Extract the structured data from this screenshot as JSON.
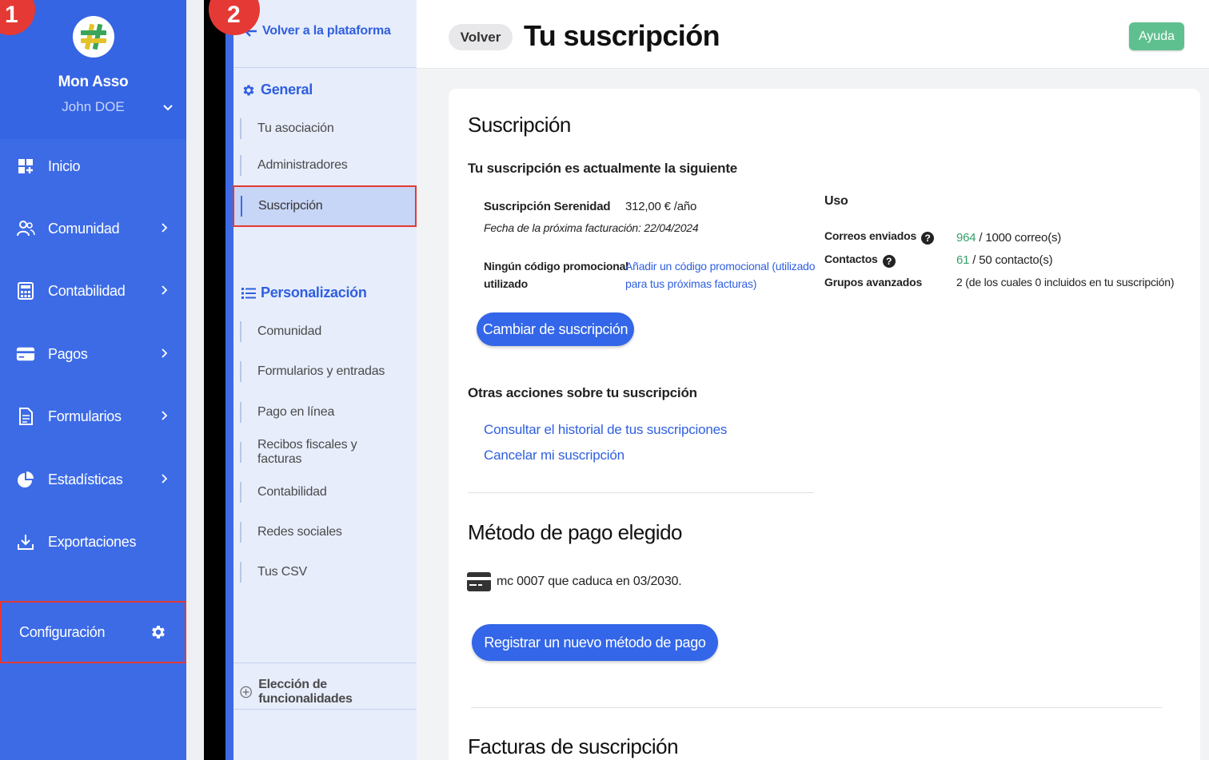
{
  "sidebar": {
    "org_name": "Mon Asso",
    "user_name": "John DOE",
    "items": [
      {
        "label": "Inicio",
        "icon": "dashboard-icon"
      },
      {
        "label": "Comunidad",
        "icon": "users-icon"
      },
      {
        "label": "Contabilidad",
        "icon": "calculator-icon"
      },
      {
        "label": "Pagos",
        "icon": "credit-card-icon"
      },
      {
        "label": "Formularios",
        "icon": "document-icon"
      },
      {
        "label": "Estadísticas",
        "icon": "pie-chart-icon"
      },
      {
        "label": "Exportaciones",
        "icon": "download-icon"
      }
    ],
    "config_label": "Configuración"
  },
  "steps": {
    "one": "1",
    "two": "2"
  },
  "subpanel": {
    "back_label": "Volver a la plataforma",
    "general_label": "General",
    "general_items": [
      "Tu asociación",
      "Administradores",
      "Suscripción"
    ],
    "personalizacion_label": "Personalización",
    "personalizacion_items": [
      "Comunidad",
      "Formularios y entradas",
      "Pago en línea",
      "Recibos fiscales y facturas",
      "Contabilidad",
      "Redes sociales",
      "Tus CSV"
    ],
    "bottom_label": "Elección de funcionalidades"
  },
  "header": {
    "back_label": "Volver",
    "title": "Tu suscripción",
    "help_label": "Ayuda"
  },
  "subscription": {
    "section_title": "Suscripción",
    "intro": "Tu suscripción es actualmente la siguiente",
    "plan_name": "Suscripción Serenidad",
    "plan_price": "312,00 € /año",
    "next_billing": "Fecha de la próxima facturación: 22/04/2024",
    "promo_label_line1": "Ningún código promocional",
    "promo_label_line2": "utilizado",
    "promo_link_line1": "Añadir un código promocional (utilizado",
    "promo_link_line2": "para tus próximas facturas)",
    "change_button": "Cambiar de suscripción",
    "usage": {
      "title": "Uso",
      "emails_label": "Correos enviados",
      "emails_used": "964",
      "emails_limit": " / 1000 correo(s)",
      "contacts_label": "Contactos",
      "contacts_used": "61",
      "contacts_limit": " / 50 contacto(s)",
      "groups_label": "Grupos avanzados",
      "groups_value": "2 (de los cuales 0 incluidos en tu suscripción)"
    },
    "other_actions_title": "Otras acciones sobre tu suscripción",
    "history_link": "Consultar el historial de tus suscripciones",
    "cancel_link": "Cancelar mi suscripción"
  },
  "payment": {
    "section_title": "Método de pago elegido",
    "card_text": "mc 0007 que caduca en 03/2030.",
    "register_button": "Registrar un nuevo método de pago"
  },
  "invoices": {
    "section_title": "Facturas de suscripción"
  }
}
